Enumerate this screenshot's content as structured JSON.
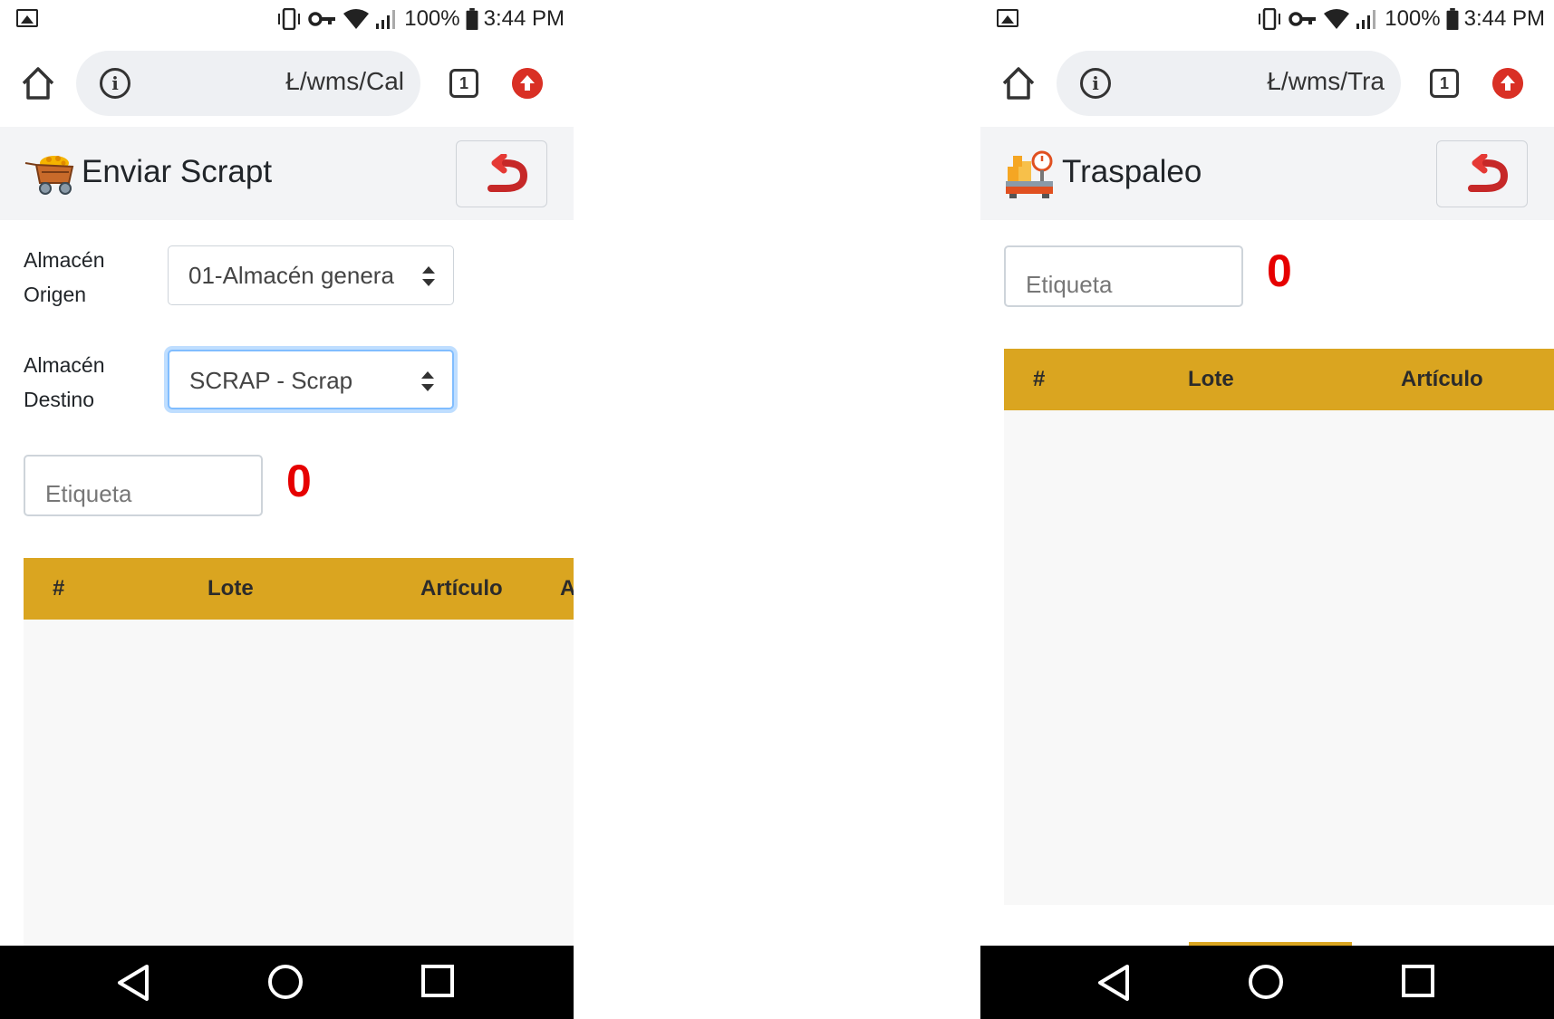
{
  "status_bar": {
    "battery": "100%",
    "time": "3:44 PM"
  },
  "left_screen": {
    "browser": {
      "url": "Ł/wms/Cal",
      "tab_count": "1"
    },
    "header": {
      "title": "Enviar Scrapt",
      "logo_icon": "mining-cart-icon",
      "back_icon": "return-arrow-icon"
    },
    "form": {
      "origin_label": "Almacén\nOrigen",
      "origin_value": "01-Almacén genera",
      "dest_label": "Almacén\nDestino",
      "dest_value": "SCRAP - Scrap"
    },
    "etiqueta": {
      "placeholder": "Etiqueta",
      "count": "0"
    },
    "table": {
      "columns": [
        "#",
        "Lote",
        "Artículo",
        "A"
      ]
    }
  },
  "right_screen": {
    "browser": {
      "url": "Ł/wms/Tra",
      "tab_count": "1"
    },
    "header": {
      "title": "Traspaleo",
      "logo_icon": "scale-boxes-icon",
      "back_icon": "return-arrow-icon"
    },
    "etiqueta": {
      "placeholder": "Etiqueta",
      "count": "0"
    },
    "table": {
      "columns": [
        "#",
        "Lote",
        "Artículo"
      ]
    }
  },
  "colors": {
    "table_header": "#daa520",
    "counter": "#e60000",
    "back_arrow": "#e53935"
  }
}
